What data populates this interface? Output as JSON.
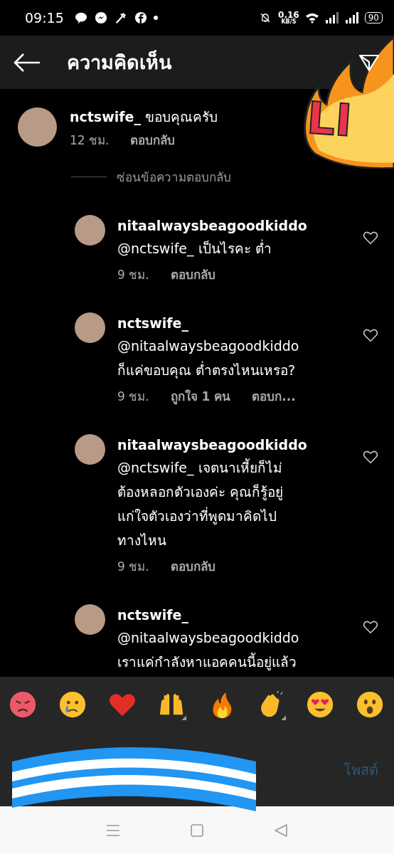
{
  "status_bar": {
    "time": "09:15",
    "speed_value": "0.16",
    "speed_unit": "KB/S",
    "battery": "90"
  },
  "header": {
    "title": "ความคิดเห็น"
  },
  "comment": {
    "text": "**nctswife_** ขอบคุณครับ",
    "time": "12 ชม.",
    "reply_label": "ตอบกลับ"
  },
  "hide_replies": "ซ่อนข้อความตอบกลับ",
  "replies": [
    {
      "username": "nitaalwaysbeagoodkiddo",
      "lines": [
        "@nctswife_ เป็นไรคะ ต่ำ"
      ],
      "time": "9 ชม.",
      "reply_label": "ตอบกลับ",
      "liked": false
    },
    {
      "username": "nctswife_",
      "lines": [
        "@nitaalwaysbeagoodkiddo",
        "ก็แค่ขอบคุณ ต่ำตรงไหนเหรอ?"
      ],
      "time": "9 ชม.",
      "likes": "ถูกใจ 1 คน",
      "reply_label": "ตอบก...",
      "liked": false
    },
    {
      "username": "nitaalwaysbeagoodkiddo",
      "lines": [
        "@nctswife_ เจตนาเหี้ยก็ไม่",
        "ต้องหลอกตัวเองค่ะ คุณก็รู้อยู่",
        "แก่ใจตัวเองว่าที่พูดมาคิดไป",
        "ทางไหน"
      ],
      "time": "9 ชม.",
      "reply_label": "ตอบกลับ",
      "liked": false
    },
    {
      "username": "nctswife_",
      "lines": [
        "@nitaalwaysbeagoodkiddo",
        "เราแค่กำลังหาแอคคนนี้อยู่แล้ว"
      ],
      "liked": false
    }
  ],
  "reactions": [
    {
      "kind": "angry",
      "variants": false
    },
    {
      "kind": "crying",
      "variants": false
    },
    {
      "kind": "heart",
      "variants": false
    },
    {
      "kind": "raised_hands",
      "variants": true
    },
    {
      "kind": "fire",
      "variants": false
    },
    {
      "kind": "clap",
      "variants": true
    },
    {
      "kind": "heart_eyes",
      "variants": false
    },
    {
      "kind": "surprised",
      "variants": false
    }
  ],
  "post_button": {
    "label": "โพสต์",
    "disabled": true
  },
  "sticker": {
    "text": "LI"
  }
}
